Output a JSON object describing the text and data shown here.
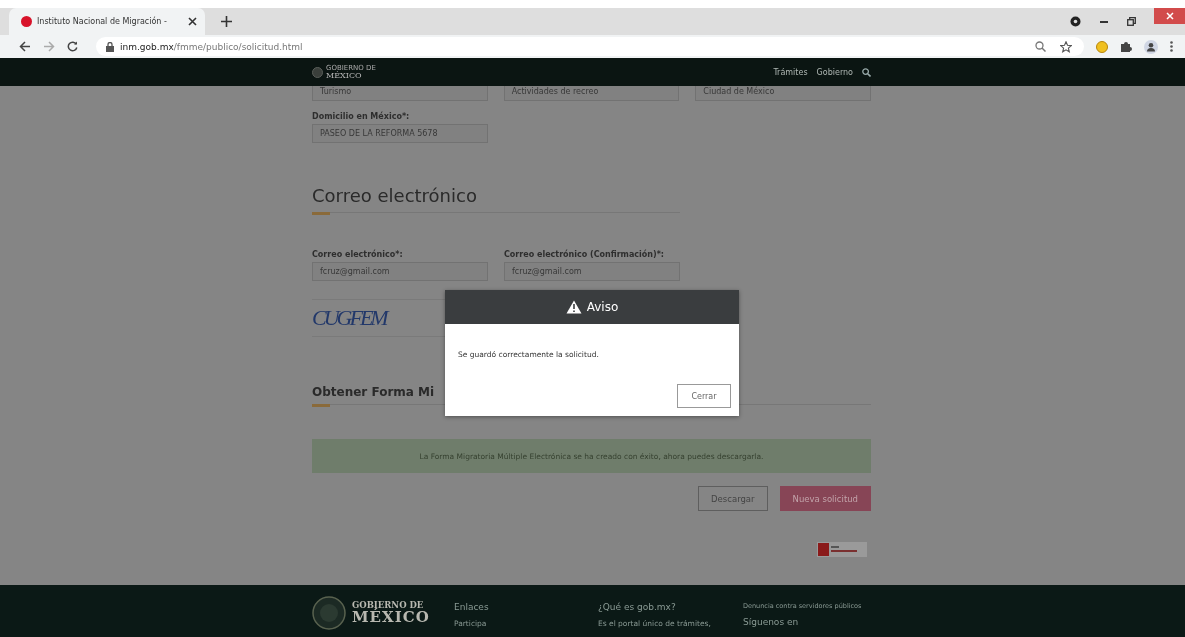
{
  "browser": {
    "tab": {
      "title": "Instituto Nacional de Migración -"
    },
    "url": {
      "domain": "inm.gob.mx",
      "path": "/fmme/publico/solicitud.html"
    }
  },
  "navbar": {
    "logo": {
      "line1": "GOBIERNO DE",
      "line2": "MÉXICO"
    },
    "links": [
      "Trámites",
      "Gobierno"
    ]
  },
  "form": {
    "top_fields": [
      "Turismo",
      "Actividades de recreo",
      "Ciudad de México"
    ],
    "address": {
      "label": "Domicilio en México*:",
      "value": "PASEO DE LA REFORMA 5678"
    },
    "email_section": {
      "heading": "Correo electrónico",
      "fields": [
        {
          "label": "Correo electrónico*:",
          "value": "fcruz@gmail.com"
        },
        {
          "label": "Correo electrónico (Confirmación)*:",
          "value": "fcruz@gmail.com"
        }
      ]
    },
    "captcha": {
      "text": "CUGFEM"
    },
    "obtain_section": {
      "heading": "Obtener Forma Mi"
    },
    "banner": "La Forma Migratoria Múltiple Electrónica se ha creado con éxito, ahora puedes descargarla.",
    "buttons": [
      {
        "label": "Descargar",
        "kind": "outline"
      },
      {
        "label": "Nueva solicitud",
        "kind": "primary"
      }
    ]
  },
  "modal": {
    "title": "Aviso",
    "message": "Se guardó correctamente la solicitud.",
    "button": "Cerrar"
  },
  "footer": {
    "logo": {
      "line1": "GOBIERNO DE",
      "line2": "MÉXICO"
    },
    "columns": [
      {
        "heading": "Enlaces",
        "text": "Participa"
      },
      {
        "heading": "¿Qué es gob.mx?",
        "text": "Es el portal único de trámites,"
      },
      {
        "heading": "Denuncia contra servidores públicos",
        "text": "Síguenos en"
      }
    ]
  }
}
